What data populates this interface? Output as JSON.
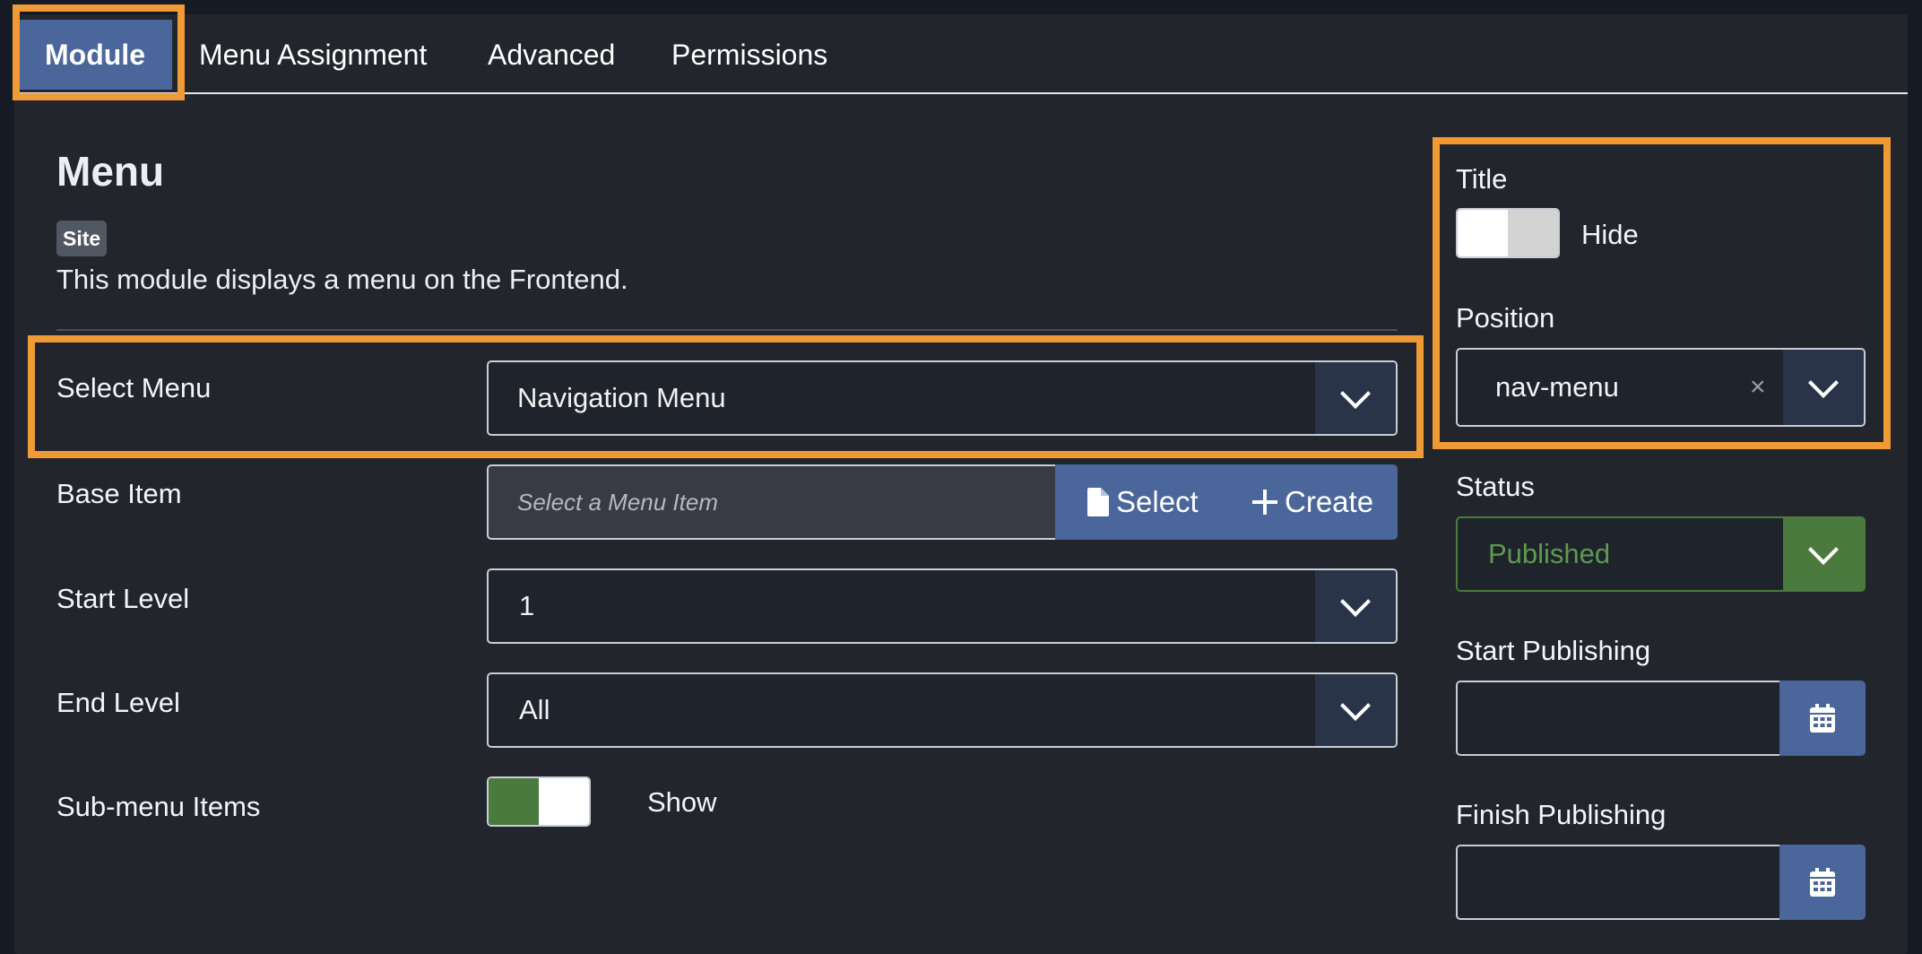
{
  "tabs": [
    "Module",
    "Menu Assignment",
    "Advanced",
    "Permissions"
  ],
  "module": {
    "title": "Menu",
    "badge": "Site",
    "description": "This module displays a menu on the Frontend."
  },
  "fields": {
    "select_menu": {
      "label": "Select Menu",
      "value": "Navigation Menu"
    },
    "base_item": {
      "label": "Base Item",
      "placeholder": "Select a Menu Item",
      "select_label": "Select",
      "create_label": "Create"
    },
    "start_level": {
      "label": "Start Level",
      "value": "1"
    },
    "end_level": {
      "label": "End Level",
      "value": "All"
    },
    "submenu_items": {
      "label": "Sub-menu Items",
      "state": "Show"
    }
  },
  "sidebar": {
    "title": {
      "label": "Title",
      "state": "Hide"
    },
    "position": {
      "label": "Position",
      "value": "nav-menu",
      "clear": "×"
    },
    "status": {
      "label": "Status",
      "value": "Published"
    },
    "start_publishing": {
      "label": "Start Publishing",
      "value": ""
    },
    "finish_publishing": {
      "label": "Finish Publishing",
      "value": ""
    }
  },
  "colors": {
    "accent_blue": "#4a669a",
    "highlight_orange": "#f09a35",
    "published_green": "#4a7a3e",
    "background": "#22252c"
  },
  "icons": {
    "file": "file-icon",
    "plus": "plus-icon",
    "calendar": "calendar-icon",
    "chevron": "chevron-down-icon"
  }
}
